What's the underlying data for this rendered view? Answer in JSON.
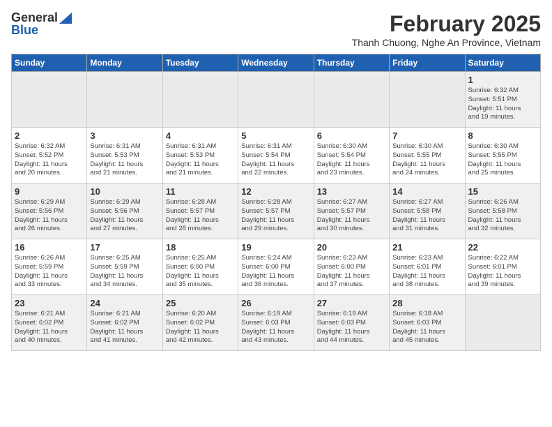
{
  "header": {
    "logo_general": "General",
    "logo_blue": "Blue",
    "month": "February 2025",
    "location": "Thanh Chuong, Nghe An Province, Vietnam"
  },
  "days_of_week": [
    "Sunday",
    "Monday",
    "Tuesday",
    "Wednesday",
    "Thursday",
    "Friday",
    "Saturday"
  ],
  "weeks": [
    [
      {
        "day": "",
        "info": ""
      },
      {
        "day": "",
        "info": ""
      },
      {
        "day": "",
        "info": ""
      },
      {
        "day": "",
        "info": ""
      },
      {
        "day": "",
        "info": ""
      },
      {
        "day": "",
        "info": ""
      },
      {
        "day": "1",
        "info": "Sunrise: 6:32 AM\nSunset: 5:51 PM\nDaylight: 11 hours\nand 19 minutes."
      }
    ],
    [
      {
        "day": "2",
        "info": "Sunrise: 6:32 AM\nSunset: 5:52 PM\nDaylight: 11 hours\nand 20 minutes."
      },
      {
        "day": "3",
        "info": "Sunrise: 6:31 AM\nSunset: 5:53 PM\nDaylight: 11 hours\nand 21 minutes."
      },
      {
        "day": "4",
        "info": "Sunrise: 6:31 AM\nSunset: 5:53 PM\nDaylight: 11 hours\nand 21 minutes."
      },
      {
        "day": "5",
        "info": "Sunrise: 6:31 AM\nSunset: 5:54 PM\nDaylight: 11 hours\nand 22 minutes."
      },
      {
        "day": "6",
        "info": "Sunrise: 6:30 AM\nSunset: 5:54 PM\nDaylight: 11 hours\nand 23 minutes."
      },
      {
        "day": "7",
        "info": "Sunrise: 6:30 AM\nSunset: 5:55 PM\nDaylight: 11 hours\nand 24 minutes."
      },
      {
        "day": "8",
        "info": "Sunrise: 6:30 AM\nSunset: 5:55 PM\nDaylight: 11 hours\nand 25 minutes."
      }
    ],
    [
      {
        "day": "9",
        "info": "Sunrise: 6:29 AM\nSunset: 5:56 PM\nDaylight: 11 hours\nand 26 minutes."
      },
      {
        "day": "10",
        "info": "Sunrise: 6:29 AM\nSunset: 5:56 PM\nDaylight: 11 hours\nand 27 minutes."
      },
      {
        "day": "11",
        "info": "Sunrise: 6:28 AM\nSunset: 5:57 PM\nDaylight: 11 hours\nand 28 minutes."
      },
      {
        "day": "12",
        "info": "Sunrise: 6:28 AM\nSunset: 5:57 PM\nDaylight: 11 hours\nand 29 minutes."
      },
      {
        "day": "13",
        "info": "Sunrise: 6:27 AM\nSunset: 5:57 PM\nDaylight: 11 hours\nand 30 minutes."
      },
      {
        "day": "14",
        "info": "Sunrise: 6:27 AM\nSunset: 5:58 PM\nDaylight: 11 hours\nand 31 minutes."
      },
      {
        "day": "15",
        "info": "Sunrise: 6:26 AM\nSunset: 5:58 PM\nDaylight: 11 hours\nand 32 minutes."
      }
    ],
    [
      {
        "day": "16",
        "info": "Sunrise: 6:26 AM\nSunset: 5:59 PM\nDaylight: 11 hours\nand 33 minutes."
      },
      {
        "day": "17",
        "info": "Sunrise: 6:25 AM\nSunset: 5:59 PM\nDaylight: 11 hours\nand 34 minutes."
      },
      {
        "day": "18",
        "info": "Sunrise: 6:25 AM\nSunset: 6:00 PM\nDaylight: 11 hours\nand 35 minutes."
      },
      {
        "day": "19",
        "info": "Sunrise: 6:24 AM\nSunset: 6:00 PM\nDaylight: 11 hours\nand 36 minutes."
      },
      {
        "day": "20",
        "info": "Sunrise: 6:23 AM\nSunset: 6:00 PM\nDaylight: 11 hours\nand 37 minutes."
      },
      {
        "day": "21",
        "info": "Sunrise: 6:23 AM\nSunset: 6:01 PM\nDaylight: 11 hours\nand 38 minutes."
      },
      {
        "day": "22",
        "info": "Sunrise: 6:22 AM\nSunset: 6:01 PM\nDaylight: 11 hours\nand 39 minutes."
      }
    ],
    [
      {
        "day": "23",
        "info": "Sunrise: 6:21 AM\nSunset: 6:02 PM\nDaylight: 11 hours\nand 40 minutes."
      },
      {
        "day": "24",
        "info": "Sunrise: 6:21 AM\nSunset: 6:02 PM\nDaylight: 11 hours\nand 41 minutes."
      },
      {
        "day": "25",
        "info": "Sunrise: 6:20 AM\nSunset: 6:02 PM\nDaylight: 11 hours\nand 42 minutes."
      },
      {
        "day": "26",
        "info": "Sunrise: 6:19 AM\nSunset: 6:03 PM\nDaylight: 11 hours\nand 43 minutes."
      },
      {
        "day": "27",
        "info": "Sunrise: 6:19 AM\nSunset: 6:03 PM\nDaylight: 11 hours\nand 44 minutes."
      },
      {
        "day": "28",
        "info": "Sunrise: 6:18 AM\nSunset: 6:03 PM\nDaylight: 11 hours\nand 45 minutes."
      },
      {
        "day": "",
        "info": ""
      }
    ]
  ]
}
